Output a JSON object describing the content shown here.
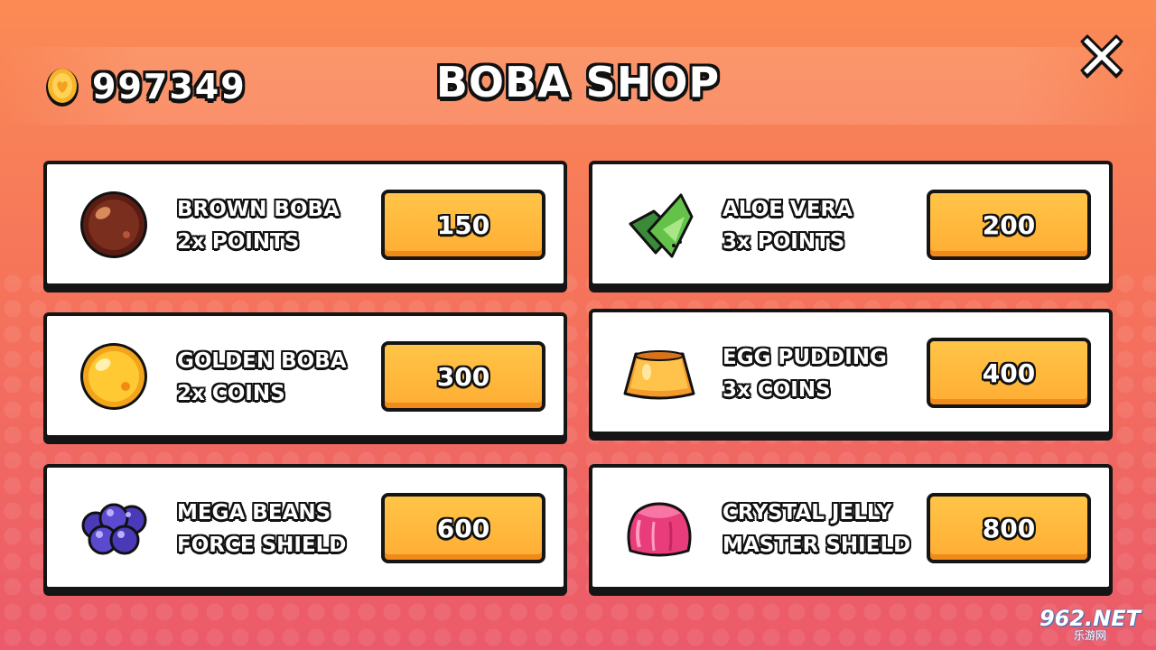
{
  "header": {
    "coins": "997349",
    "title": "BOBA SHOP"
  },
  "items": [
    {
      "line1": "BROWN BOBA",
      "line2": "2x POINTS",
      "price": "150",
      "icon": "brown-boba-icon"
    },
    {
      "line1": "ALOE VERA",
      "line2": "3x POINTS",
      "price": "200",
      "icon": "aloe-vera-icon"
    },
    {
      "line1": "GOLDEN BOBA",
      "line2": "2x COINS",
      "price": "300",
      "icon": "golden-boba-icon"
    },
    {
      "line1": "EGG PUDDING",
      "line2": "3x COINS",
      "price": "400",
      "icon": "egg-pudding-icon"
    },
    {
      "line1": "MEGA BEANS",
      "line2": "FORCE SHIELD",
      "price": "600",
      "icon": "mega-beans-icon"
    },
    {
      "line1": "CRYSTAL JELLY",
      "line2": "MASTER SHIELD",
      "price": "800",
      "icon": "crystal-jelly-icon"
    }
  ],
  "watermark": {
    "main": "962.NET",
    "sub": "乐游网"
  },
  "colors": {
    "button_fill": "#ffb83d",
    "outline": "#151515",
    "background_top": "#fb8b55",
    "background_bottom": "#eb5a6a"
  }
}
